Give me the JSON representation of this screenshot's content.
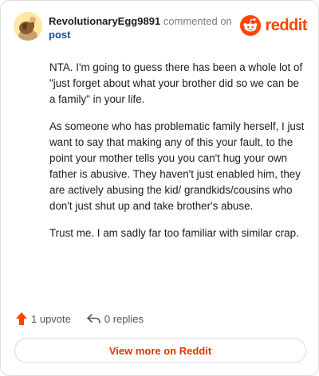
{
  "header": {
    "username": "RevolutionaryEgg9891",
    "action_text": "commented on",
    "post_link": "post",
    "logo_text": "reddit",
    "logo_icon": "reddit-alien-icon"
  },
  "comment": {
    "paragraphs": [
      "NTA. I'm going to guess there has been a whole lot of \"just forget about what your brother did so we can be a family\" in your life.",
      "As someone who has problematic family herself, I just want to say that making any of this your fault, to the point your mother tells you you can't hug your own father is abusive. They haven't just enabled him, they are actively abusing the kid/ grandkids/cousins who don't just shut up and take brother's abuse.",
      "Trust me. I am sadly far too familiar with similar crap."
    ]
  },
  "actions": {
    "upvote_label": "1 upvote",
    "replies_label": "0 replies"
  },
  "footer": {
    "view_more_label": "View more on Reddit"
  },
  "colors": {
    "brand": "#ff4500",
    "link": "#0a4fa6",
    "view_more": "#d93a00"
  }
}
